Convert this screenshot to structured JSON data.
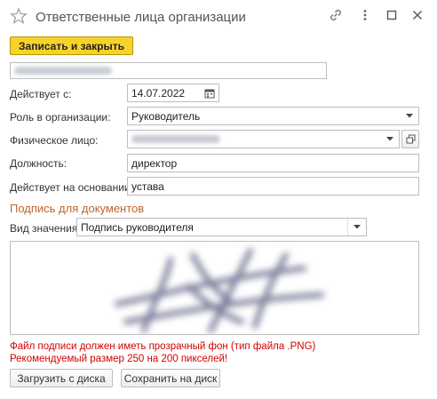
{
  "window": {
    "title": "Ответственные лица организации"
  },
  "toolbar": {
    "save_close_label": "Записать и закрыть"
  },
  "form": {
    "active_from_label": "Действует с:",
    "active_from_value": "14.07.2022",
    "role_label": "Роль в организации:",
    "role_value": "Руководитель",
    "person_label": "Физическое лицо:",
    "position_label": "Должность:",
    "position_value": "директор",
    "basis_label": "Действует на основании:",
    "basis_value": "устава"
  },
  "signature": {
    "section_title": "Подпись для документов",
    "kind_label": "Вид значения:",
    "kind_value": "Подпись руководителя",
    "warning_line1": "Файл подписи должен иметь прозрачный фон (тип файла .PNG)",
    "warning_line2": "Рекомендуемый размер 250 на 200 пикселей!",
    "load_button": "Загрузить с диска",
    "save_button": "Сохранить на диск"
  },
  "icons": {
    "favorite": "star-icon",
    "link": "link-icon",
    "more": "more-vertical-icon",
    "maximize": "maximize-icon",
    "close": "close-icon",
    "calendar": "calendar-icon",
    "dropdown": "chevron-down-icon",
    "open": "open-form-icon"
  },
  "colors": {
    "primary_button": "#f6d22b",
    "section_title": "#c0642a",
    "warning": "#d40000"
  }
}
